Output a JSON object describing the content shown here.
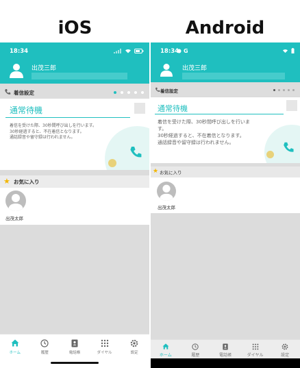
{
  "titles": {
    "ios": "iOS",
    "android": "Android"
  },
  "ios": {
    "status_time": "18:34",
    "user_name": "出茂三郎",
    "section_title": "着信設定",
    "mode_title": "通常待機",
    "description": "着信を受けた際、30秒間呼び出しを行います。\n30秒経過すると、不在着信となります。\n通話録音や留守録は行われません。",
    "favorites_title": "お気に入り",
    "favorite_contact": "出茂太郎",
    "tabs": [
      "ホーム",
      "履歴",
      "電話帳",
      "ダイヤル",
      "設定"
    ]
  },
  "android": {
    "status_time": "18:34",
    "status_g": "G",
    "user_name": "出茂三郎",
    "section_title": "着信設定",
    "mode_title": "通常待機",
    "description": "着信を受けた際、30秒間呼び出しを行いま\nす。\n30秒経過すると、不在着信となります。\n通話録音や留守録は行われません。",
    "favorites_title": "お気に入り",
    "favorite_contact": "出茂太郎",
    "tabs": [
      "ホーム",
      "履歴",
      "電話帳",
      "ダイヤル",
      "設定"
    ]
  },
  "colors": {
    "accent": "#1fbfbf",
    "background": "#dcdcdc",
    "star": "#f2b600"
  },
  "icons": {
    "tabs": [
      "home-icon",
      "history-icon",
      "phonebook-icon",
      "dialpad-icon",
      "settings-gear-icon"
    ]
  }
}
